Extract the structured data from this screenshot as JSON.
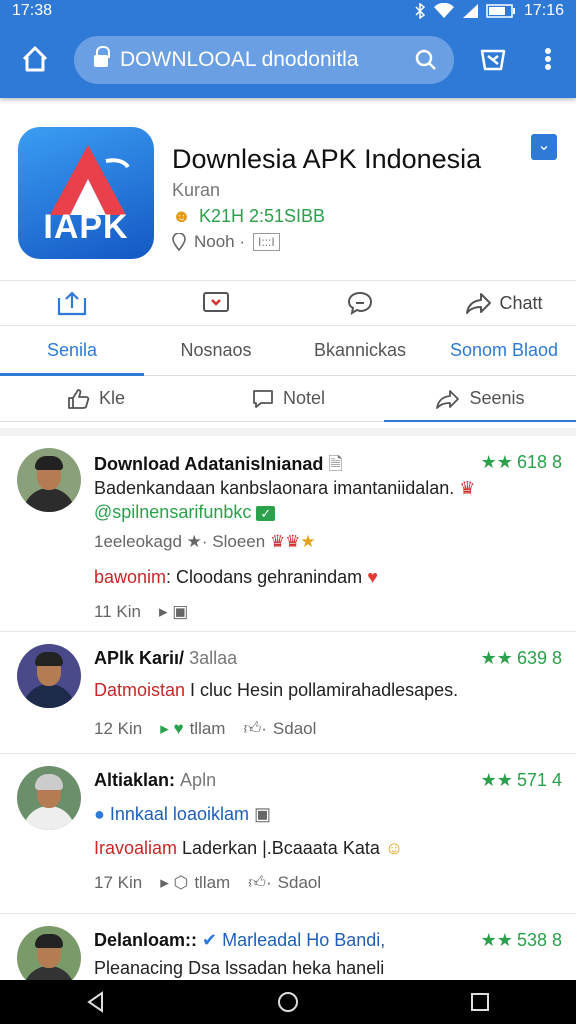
{
  "status": {
    "time": "17:38",
    "right_time": "17:16"
  },
  "browser": {
    "url": "DOWNLOOAL dnodonitla",
    "icons": [
      "home-icon",
      "lock-icon",
      "search-icon",
      "tabs-icon",
      "more-icon"
    ]
  },
  "app": {
    "logo_text": "IAPK",
    "title": "Downlesia APK Indonesia",
    "subtitle": "Kuran",
    "size": "K21H 2:51SIBB",
    "meta": "Nooh ·",
    "meta_tag": "I:::I",
    "accent": "#2f7ad6"
  },
  "actions": [
    {
      "label": "",
      "icon": "share-box-icon"
    },
    {
      "label": "",
      "icon": "save-icon"
    },
    {
      "label": "",
      "icon": "chat-icon"
    },
    {
      "label": "Chatt",
      "icon": "forward-icon"
    }
  ],
  "tabs": [
    {
      "label": "Senila",
      "active": true
    },
    {
      "label": "Nosnaos"
    },
    {
      "label": "Bkannickas"
    },
    {
      "label": "Sonom Blaod"
    }
  ],
  "reactions": [
    {
      "label": "Kle",
      "icon": "thumb-up-icon"
    },
    {
      "label": "Notel",
      "icon": "comment-icon"
    },
    {
      "label": "Seenis",
      "icon": "share-icon",
      "active": true
    }
  ],
  "posts": [
    {
      "name": "Download Adatanislnianad",
      "name_extra": "",
      "rating": "618 8",
      "text": "Badenkandaan kanbslaonara imantaniidalan.",
      "sub": "@spilnensarifunbkc",
      "meta": "1eeleokagd  ★· Sloeen",
      "alert_red": "bawonim",
      "alert_rest": ": Cloodans gehranindam",
      "time": "11 Kin",
      "foot_a": "",
      "foot_b": ""
    },
    {
      "name": "APlk Kariı/",
      "name_extra": "3allaa",
      "rating": "639 8",
      "text_red": "Datmoistan",
      "text": " I cluc Hesin pollamirahadlesapes.",
      "time": "12 Kin",
      "foot_a": "tllam",
      "foot_b": "Sdaol"
    },
    {
      "name": "Altiaklan:",
      "name_extra": "Apln",
      "rating": "571 4",
      "sub_blue": "Innkaal loaoiklam",
      "text_red": "Iravoaliam",
      "text": " Laderkan |.Bcaaata Kata",
      "time": "17 Kin",
      "foot_a": "tllam",
      "foot_b": "Sdaol"
    },
    {
      "name": "Delanloam::",
      "name_extra": "Marleadal Ho Bandi,",
      "rating": "538 8",
      "text": "Pleanacing Dsa lssadan heka haneli",
      "time": "",
      "foot_a": "",
      "foot_b": ""
    }
  ]
}
